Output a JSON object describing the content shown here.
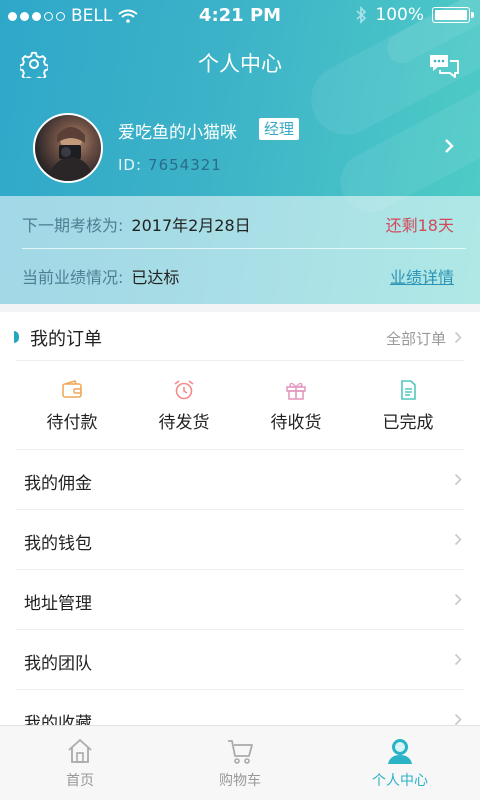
{
  "status_bar": {
    "carrier": "BELL",
    "time": "4:21 PM",
    "battery": "100%"
  },
  "nav": {
    "title": "个人中心"
  },
  "profile": {
    "username": "爱吃鱼的小猫咪",
    "role": "经理",
    "id_label": "ID:",
    "id_value": "7654321"
  },
  "assessment": {
    "next_label": "下一期考核为:",
    "next_date": "2017年2月28日",
    "remaining": "还剩18天",
    "perf_label": "当前业绩情况:",
    "perf_value": "已达标",
    "perf_link": "业绩详情"
  },
  "orders": {
    "title": "我的订单",
    "all_label": "全部订单",
    "tabs": [
      {
        "label": "待付款",
        "icon": "wallet-icon"
      },
      {
        "label": "待发货",
        "icon": "alarm-clock-icon"
      },
      {
        "label": "待收货",
        "icon": "gift-icon"
      },
      {
        "label": "已完成",
        "icon": "document-icon"
      }
    ]
  },
  "menu": [
    {
      "label": "我的佣金"
    },
    {
      "label": "我的钱包"
    },
    {
      "label": "地址管理"
    },
    {
      "label": "我的团队"
    },
    {
      "label": "我的收藏"
    }
  ],
  "tabbar": [
    {
      "label": "首页",
      "icon": "home-icon"
    },
    {
      "label": "购物车",
      "icon": "cart-icon"
    },
    {
      "label": "个人中心",
      "icon": "user-icon",
      "active": true
    }
  ],
  "colors": {
    "accent": "#2ab3c6",
    "warning": "#d04a5a",
    "header_start": "#2fa7c9",
    "header_end": "#4fcdc6"
  }
}
